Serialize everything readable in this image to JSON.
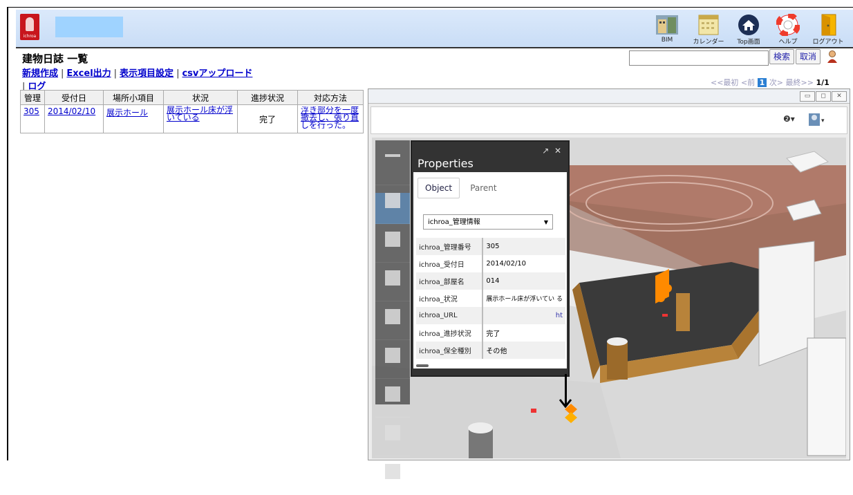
{
  "header": {
    "logo_text": "ichroa",
    "buttons": [
      {
        "label": "BIM",
        "icon": "bim-icon"
      },
      {
        "label": "カレンダー",
        "icon": "calendar-icon"
      },
      {
        "label": "Top画面",
        "icon": "home-icon"
      },
      {
        "label": "ヘルプ",
        "icon": "lifebuoy-icon"
      },
      {
        "label": "ログアウト",
        "icon": "door-icon"
      }
    ]
  },
  "page": {
    "title": "建物日誌 一覧",
    "links": [
      "新規作成",
      "Excel出力",
      "表示項目設定",
      "csvアップロード",
      "ログ"
    ],
    "search_placeholder": "",
    "search_button": "検索",
    "cancel_button": "取消"
  },
  "pager": {
    "first": "<<最初",
    "prev": "<前",
    "current": "1",
    "next": "次>",
    "last": "最終>>",
    "count": "1/1"
  },
  "table": {
    "columns": [
      "管理",
      "受付日",
      "場所小項目",
      "状況",
      "進捗状況",
      "対応方法"
    ],
    "rows": [
      {
        "id": "305",
        "date": "2014/02/10",
        "place": "展示ホール",
        "status": "展示ホール床が浮いている",
        "progress": "完了",
        "method": "浮き部分を一度撤去し、張り直しを行った。"
      }
    ]
  },
  "properties": {
    "title": "Properties",
    "tabs": [
      "Object",
      "Parent"
    ],
    "dropdown": "ichroa_管理情報",
    "rows": [
      {
        "key": "ichroa_管理番号",
        "value": "305"
      },
      {
        "key": "ichroa_受付日",
        "value": "2014/02/10"
      },
      {
        "key": "ichroa_部屋名",
        "value": "014"
      },
      {
        "key": "ichroa_状況",
        "value": "展示ホール床が浮いてい る"
      },
      {
        "key": "ichroa_URL",
        "value": "ht"
      },
      {
        "key": "ichroa_進捗状況",
        "value": "完了"
      },
      {
        "key": "ichroa_保全種別",
        "value": "その他"
      }
    ]
  },
  "colors": {
    "header_bg": "#c9ddf6",
    "link": "#0000cc",
    "logo": "#c8161d",
    "marker": "#ff8a00",
    "pager_current": "#2b7fd3"
  }
}
